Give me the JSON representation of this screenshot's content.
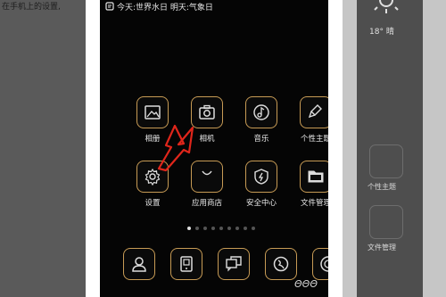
{
  "background": {
    "left_text": "在手机上的设置,",
    "right_weather": "18° 晴",
    "right_labels": [
      "个性主题",
      "文件管理"
    ]
  },
  "status_bar": {
    "weather_icon": "thermometer-icon",
    "text": "今天:世界水日 明天:气象日"
  },
  "apps": [
    {
      "label": "相册",
      "icon": "gallery-icon"
    },
    {
      "label": "相机",
      "icon": "camera-icon"
    },
    {
      "label": "音乐",
      "icon": "music-icon"
    },
    {
      "label": "个性主题",
      "icon": "theme-brush-icon"
    },
    {
      "label": "设置",
      "icon": "settings-gear-icon"
    },
    {
      "label": "应用商店",
      "icon": "app-store-bag-icon"
    },
    {
      "label": "安全中心",
      "icon": "security-shield-icon"
    },
    {
      "label": "文件管理",
      "icon": "file-folder-icon"
    }
  ],
  "page_indicator": {
    "count": 9,
    "active": 1
  },
  "dock": [
    {
      "icon": "contacts-icon"
    },
    {
      "icon": "phone-icon"
    },
    {
      "icon": "messages-icon"
    },
    {
      "icon": "browser-icon"
    },
    {
      "icon": "camera-lens-icon"
    }
  ],
  "colors": {
    "tile_border": "#c79b55",
    "arrow": "#e0261b",
    "screen_bg": "#050505"
  }
}
